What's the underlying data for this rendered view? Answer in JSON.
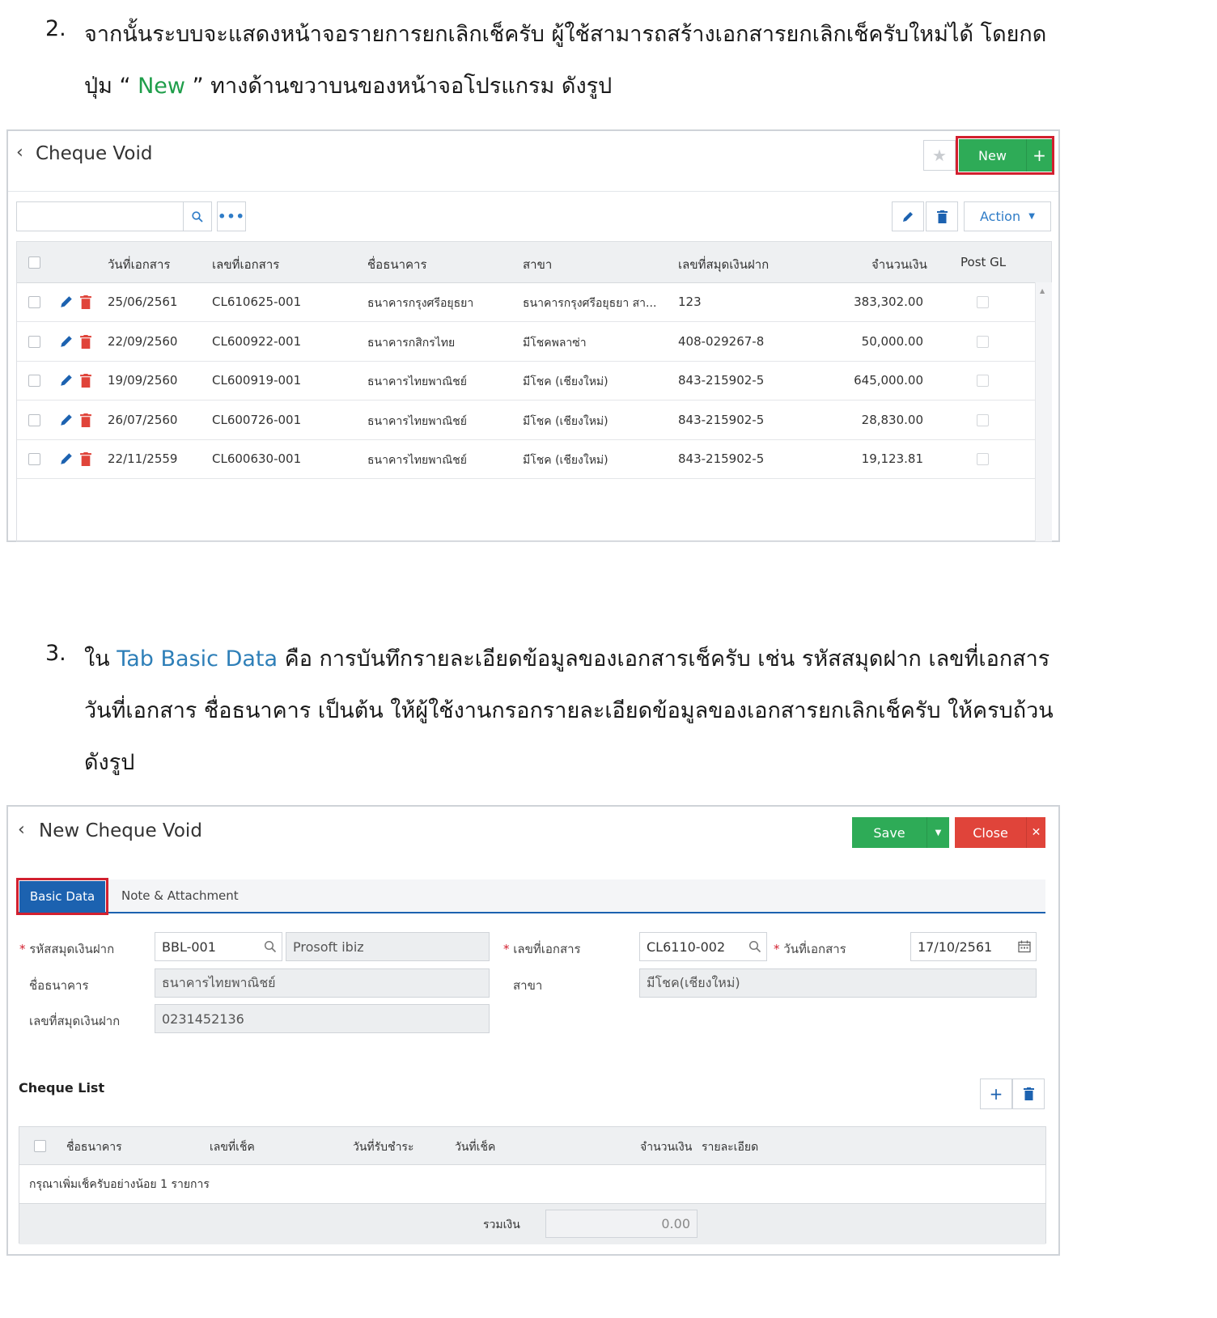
{
  "step2": {
    "number": "2.",
    "line1": "จากนั้นระบบจะแสดงหน้าจอรายการยกเลิกเช็ครับ ผู้ใช้สามารถสร้างเอกสารยกเลิกเช็ครับใหม่ได้ โดยกด",
    "line2_pre": "ปุ่ม “",
    "line2_new": "New",
    "line2_post": "” ทางด้านขวาบนของหน้าจอโปรแกรม ดังรูป"
  },
  "list_screen": {
    "title": "Cheque Void",
    "new_button": "New",
    "action_button": "Action",
    "columns": [
      "วันที่เอกสาร",
      "เลขที่เอกสาร",
      "ชื่อธนาคาร",
      "สาขา",
      "เลขที่สมุดเงินฝาก",
      "จำนวนเงิน",
      "Post GL"
    ],
    "rows": [
      {
        "date": "25/06/2561",
        "doc_no": "CL610625-001",
        "bank": "ธนาคารกรุงศรีอยุธยา",
        "branch": "ธนาคารกรุงศรีอยุธยา สา...",
        "account": "123",
        "amount": "383,302.00"
      },
      {
        "date": "22/09/2560",
        "doc_no": "CL600922-001",
        "bank": "ธนาคารกสิกรไทย",
        "branch": "มีโชคพลาซ่า",
        "account": "408-029267-8",
        "amount": "50,000.00"
      },
      {
        "date": "19/09/2560",
        "doc_no": "CL600919-001",
        "bank": "ธนาคารไทยพาณิชย์",
        "branch": "มีโชค (เชียงใหม่)",
        "account": "843-215902-5",
        "amount": "645,000.00"
      },
      {
        "date": "26/07/2560",
        "doc_no": "CL600726-001",
        "bank": "ธนาคารไทยพาณิชย์",
        "branch": "มีโชค (เชียงใหม่)",
        "account": "843-215902-5",
        "amount": "28,830.00"
      },
      {
        "date": "22/11/2559",
        "doc_no": "CL600630-001",
        "bank": "ธนาคารไทยพาณิชย์",
        "branch": "มีโชค (เชียงใหม่)",
        "account": "843-215902-5",
        "amount": "19,123.81"
      }
    ]
  },
  "step3": {
    "number": "3.",
    "line1_pre": "ใน",
    "line1_tab": "Tab Basic Data",
    "line1_post": "คือ การบันทึกรายละเอียดข้อมูลของเอกสารเช็ครับ เช่น รหัสสมุดฝาก เลขที่เอกสาร",
    "line2": "วันที่เอกสาร ชื่อธนาคาร เป็นต้น ให้ผู้ใช้งานกรอกรายละเอียดข้อมูลของเอกสารยกเลิกเช็ครับ ให้ครบถ้วน",
    "line3": "ดังรูป"
  },
  "form_screen": {
    "title": "New Cheque Void",
    "save_button": "Save",
    "close_button": "Close",
    "tabs": [
      "Basic Data",
      "Note & Attachment"
    ],
    "fields": {
      "bankbook_code_label": "รหัสสมุดเงินฝาก",
      "bankbook_code": "BBL-001",
      "company": "Prosoft ibiz",
      "doc_no_label": "เลขที่เอกสาร",
      "doc_no": "CL6110-002",
      "doc_date_label": "วันที่เอกสาร",
      "doc_date": "17/10/2561",
      "bank_name_label": "ชื่อธนาคาร",
      "bank_name": "ธนาคารไทยพาณิชย์",
      "branch_label": "สาขา",
      "branch": "มีโชค(เชียงใหม่)",
      "account_label": "เลขที่สมุดเงินฝาก",
      "account": "0231452136"
    },
    "cheque_list": {
      "title": "Cheque List",
      "columns": [
        "ชื่อธนาคาร",
        "เลขที่เช็ค",
        "วันที่รับชำระ",
        "วันที่เช็ค",
        "จำนวนเงิน",
        "รายละเอียด"
      ],
      "empty_message": "กรุณาเพิ่มเช็ครับอย่างน้อย 1 รายการ",
      "total_label": "รวมเงิน",
      "total_value": "0.00"
    }
  },
  "colors": {
    "green": "#2eab57",
    "red": "#e0443a",
    "blue": "#1c62b0",
    "highlight": "#d2202f"
  }
}
